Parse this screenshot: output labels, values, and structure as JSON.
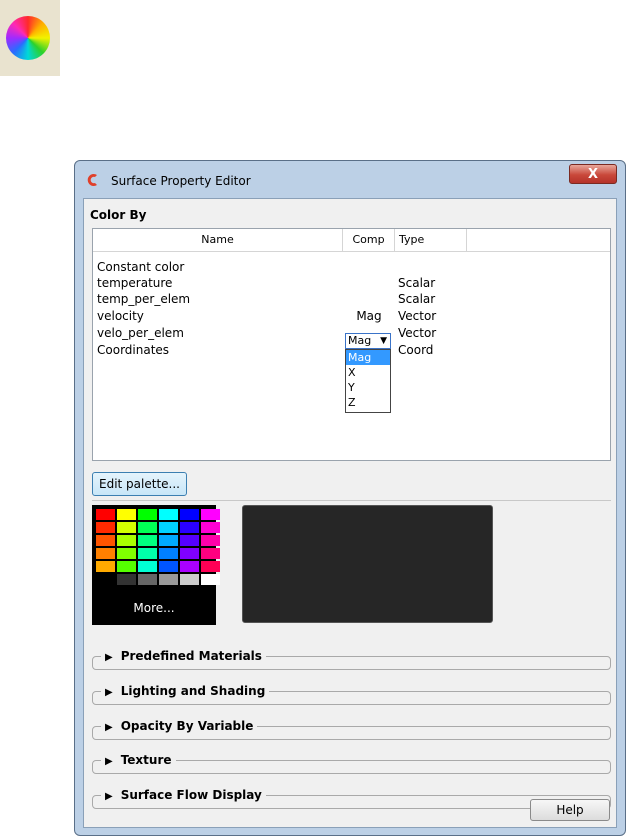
{
  "window": {
    "title": "Surface Property Editor",
    "close_label": "X"
  },
  "color_by": {
    "label": "Color By",
    "columns": {
      "name": "Name",
      "comp": "Comp",
      "type": "Type"
    },
    "rows": [
      {
        "name": "Constant color",
        "comp": "",
        "type": ""
      },
      {
        "name": "temperature",
        "comp": "",
        "type": "Scalar"
      },
      {
        "name": "temp_per_elem",
        "comp": "",
        "type": "Scalar"
      },
      {
        "name": "velocity",
        "comp": "Mag",
        "type": "Vector"
      },
      {
        "name": "velo_per_elem",
        "comp": "",
        "type": "Vector"
      },
      {
        "name": "Coordinates",
        "comp": "",
        "type": "Coord"
      }
    ],
    "comp_select": {
      "value": "Mag",
      "options": [
        "Mag",
        "X",
        "Y",
        "Z"
      ],
      "highlighted": "Mag"
    }
  },
  "palette": {
    "edit_label": "Edit palette...",
    "more_label": "More...",
    "swatches": [
      "#ff0000",
      "#ffff00",
      "#00ff00",
      "#00ffff",
      "#0000ff",
      "#ff00ff",
      "#ff2a00",
      "#d4ff00",
      "#00ff55",
      "#00d4ff",
      "#2a00ff",
      "#ff00d4",
      "#ff5500",
      "#aaff00",
      "#00ff80",
      "#00aaff",
      "#5500ff",
      "#ff00aa",
      "#ff8000",
      "#80ff00",
      "#00ffaa",
      "#0080ff",
      "#8000ff",
      "#ff0080",
      "#ffaa00",
      "#55ff00",
      "#00ffd4",
      "#0055ff",
      "#aa00ff",
      "#ff0055",
      "#000000",
      "#333333",
      "#666666",
      "#999999",
      "#cccccc",
      "#ffffff"
    ]
  },
  "sections": [
    {
      "label": "Predefined Materials"
    },
    {
      "label": "Lighting and Shading"
    },
    {
      "label": "Opacity By Variable"
    },
    {
      "label": "Texture"
    },
    {
      "label": "Surface Flow Display"
    }
  ],
  "help_label": "Help",
  "colors": {
    "window_frame": "#bcd0e6",
    "client_bg": "#f0f0f0",
    "selection": "#3399ff",
    "close_button": "#c9483a"
  }
}
